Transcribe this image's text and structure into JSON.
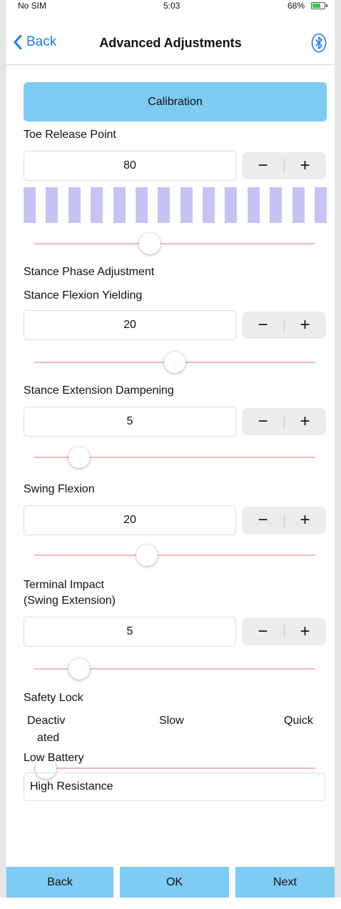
{
  "status_bar": {
    "carrier": "No SIM",
    "time": "5:03",
    "battery": "68%"
  },
  "nav": {
    "back_label": "Back",
    "title": "Advanced Adjustments",
    "bluetooth_icon": "bluetooth-icon"
  },
  "calibration_label": "Calibration",
  "toe_release": {
    "label": "Toe Release Point",
    "value": "80",
    "slider_fraction": 0.41,
    "bar_count": 14
  },
  "stance_section_label": "Stance Phase Adjustment",
  "stance_flexion": {
    "label": "Stance Flexion Yielding",
    "value": "20",
    "slider_fraction": 0.5
  },
  "stance_extension": {
    "label": "Stance Extension Dampening",
    "value": "5",
    "slider_fraction": 0.16
  },
  "swing_flexion": {
    "label": "Swing Flexion",
    "value": "20",
    "slider_fraction": 0.4
  },
  "terminal_impact": {
    "label_line1": "Terminal Impact",
    "label_line2": "(Swing Extension)",
    "value": "5",
    "slider_fraction": 0.16
  },
  "safety_lock": {
    "label": "Safety Lock",
    "options": {
      "deactivated_line1": "Deactiv",
      "deactivated_line2": "ated",
      "slow": "Slow",
      "quick": "Quick"
    },
    "selected": "Deactivated",
    "slider_fraction": 0.04
  },
  "low_battery": {
    "label": "Low Battery",
    "value": "High Resistance"
  },
  "stepper": {
    "minus": "−",
    "plus": "+"
  },
  "bottom_bar": {
    "back": "Back",
    "ok": "OK",
    "next": "Next"
  },
  "colors": {
    "accent_blue": "#1a7ef5",
    "button_blue": "#7ecbf3",
    "track_pink": "#f2b8bc",
    "bar_purple": "#c4c3f4"
  }
}
